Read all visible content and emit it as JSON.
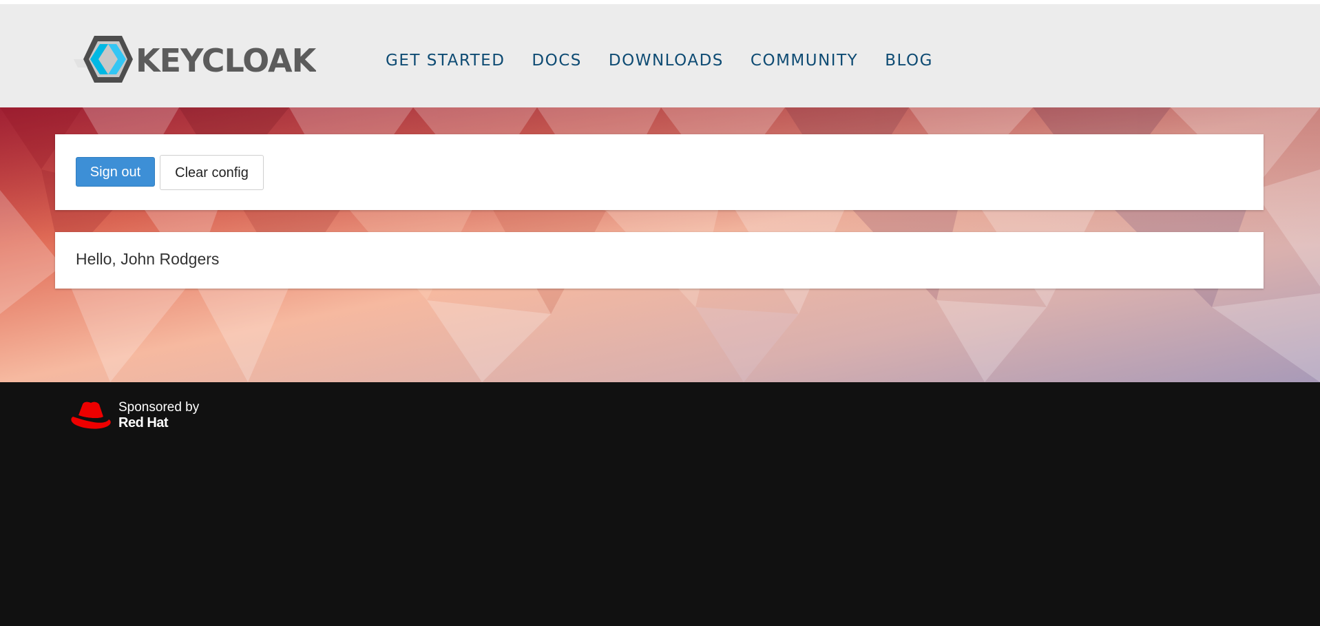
{
  "header": {
    "logo_text": "KEYCLOAK",
    "nav": [
      {
        "label": "GET STARTED"
      },
      {
        "label": "DOCS"
      },
      {
        "label": "DOWNLOADS"
      },
      {
        "label": "COMMUNITY"
      },
      {
        "label": "BLOG"
      }
    ]
  },
  "actions": {
    "sign_out_label": "Sign out",
    "clear_config_label": "Clear config"
  },
  "greeting": {
    "text": "Hello, John Rodgers"
  },
  "footer": {
    "sponsored_text": "Sponsored by",
    "brand_text": "Red Hat"
  },
  "colors": {
    "nav_text": "#0e4b73",
    "primary_button": "#3d8fd6",
    "header_bg": "#ececec",
    "footer_bg": "#111111",
    "redhat_red": "#ee0000"
  },
  "icons": {
    "logo": "keycloak-logo-icon",
    "redhat": "redhat-hat-icon"
  }
}
